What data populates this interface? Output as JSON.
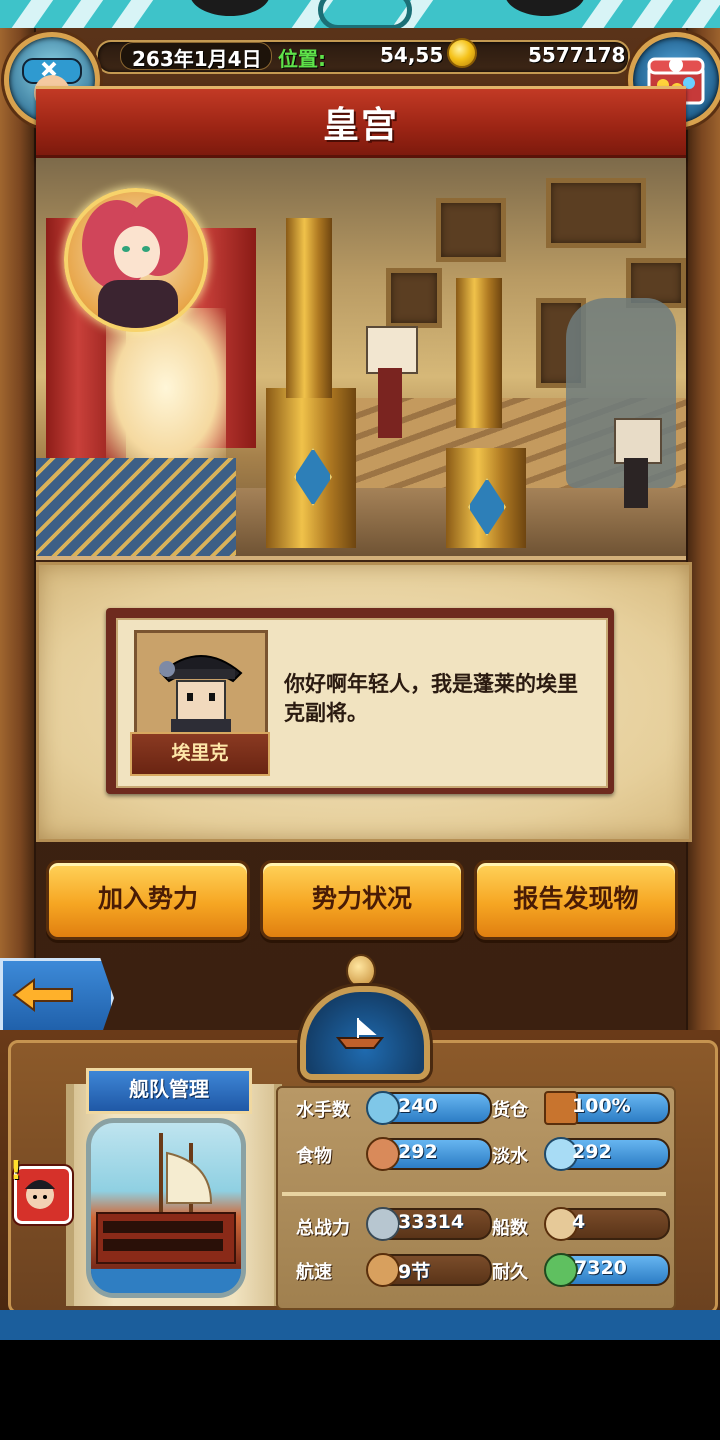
{
  "status": {
    "date": "263年1月4日",
    "position_label": "位置:",
    "position_value": "54,55",
    "gold": "5577178"
  },
  "location": {
    "title": "皇宫"
  },
  "dialog": {
    "npc_name": "埃里克",
    "text": "你好啊年轻人，我是蓬莱的埃里克副将。"
  },
  "actions": [
    {
      "label": "加入势力"
    },
    {
      "label": "势力状况"
    },
    {
      "label": "报告发现物"
    }
  ],
  "fleet": {
    "title": "舰队管理",
    "stats": {
      "sailors": {
        "label": "水手数",
        "value": "240"
      },
      "cargo": {
        "label": "货仓",
        "value": "100%"
      },
      "food": {
        "label": "食物",
        "value": "292"
      },
      "water": {
        "label": "淡水",
        "value": "292"
      },
      "power": {
        "label": "总战力",
        "value": "33314"
      },
      "ships": {
        "label": "船数",
        "value": "4"
      },
      "speed": {
        "label": "航速",
        "value": "9节"
      },
      "durability": {
        "label": "耐久",
        "value": "7320"
      }
    }
  },
  "icons": {
    "avatar": "pirate-avatar-icon",
    "chest": "treasure-chest-icon",
    "coin": "gold-coin-icon",
    "back": "back-arrow-icon",
    "compass": "ship-compass-icon",
    "alert": "crew-alert-icon"
  },
  "colors": {
    "accent_gold": "#f6a623",
    "banner_red": "#9b2414",
    "panel_blue": "#2d7dc5"
  }
}
